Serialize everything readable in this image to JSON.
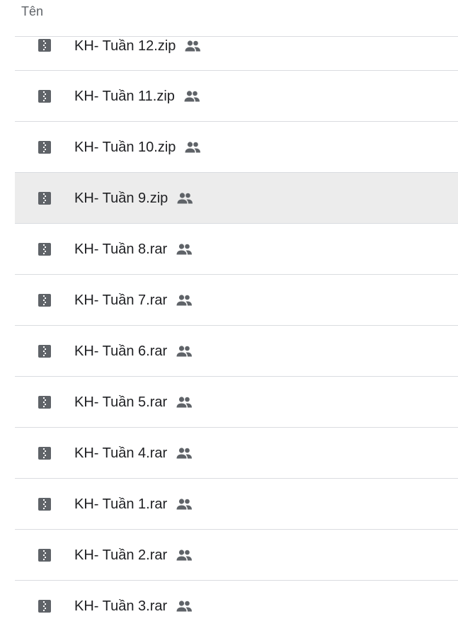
{
  "header": {
    "column_label": "Tên"
  },
  "files": [
    {
      "name": "KH- Tuần 12.zip",
      "type_icon": "zip-file-icon",
      "shared_icon": "shared-people-icon"
    },
    {
      "name": "KH- Tuần 11.zip",
      "type_icon": "zip-file-icon",
      "shared_icon": "shared-people-icon"
    },
    {
      "name": "KH- Tuần 10.zip",
      "type_icon": "zip-file-icon",
      "shared_icon": "shared-people-icon"
    },
    {
      "name": "KH- Tuần 9.zip",
      "type_icon": "zip-file-icon",
      "shared_icon": "shared-people-icon",
      "selected": true
    },
    {
      "name": "KH- Tuần 8.rar",
      "type_icon": "zip-file-icon",
      "shared_icon": "shared-people-icon"
    },
    {
      "name": "KH- Tuần 7.rar",
      "type_icon": "zip-file-icon",
      "shared_icon": "shared-people-icon"
    },
    {
      "name": "KH- Tuần 6.rar",
      "type_icon": "zip-file-icon",
      "shared_icon": "shared-people-icon"
    },
    {
      "name": "KH- Tuần 5.rar",
      "type_icon": "zip-file-icon",
      "shared_icon": "shared-people-icon"
    },
    {
      "name": "KH- Tuần 4.rar",
      "type_icon": "zip-file-icon",
      "shared_icon": "shared-people-icon"
    },
    {
      "name": "KH- Tuần 1.rar",
      "type_icon": "zip-file-icon",
      "shared_icon": "shared-people-icon"
    },
    {
      "name": "KH- Tuần 2.rar",
      "type_icon": "zip-file-icon",
      "shared_icon": "shared-people-icon"
    },
    {
      "name": "KH- Tuần 3.rar",
      "type_icon": "zip-file-icon",
      "shared_icon": "shared-people-icon"
    }
  ],
  "colors": {
    "selected_row_bg": "#ececec",
    "divider": "#dadce0",
    "icon": "#5f6368",
    "text": "#202124"
  }
}
